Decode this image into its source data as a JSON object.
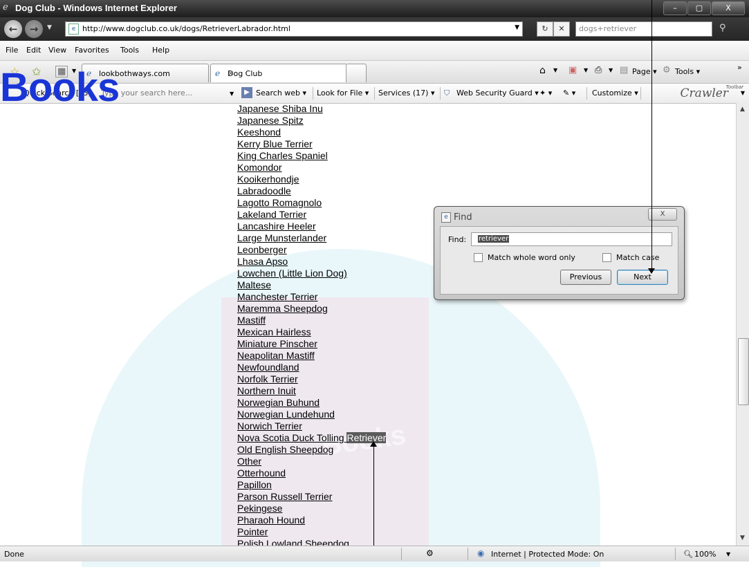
{
  "window": {
    "title": "Dog Club - Windows Internet Explorer",
    "buttons": [
      "–",
      "▢",
      "X"
    ]
  },
  "address_bar": {
    "url": "http://www.dogclub.co.uk/dogs/RetrieverLabrador.html",
    "search_value": "dogs+retriever"
  },
  "menu": [
    "File",
    "Edit",
    "View",
    "Favorites",
    "Tools",
    "Help"
  ],
  "tabs": [
    {
      "label": "lookbothways.com",
      "active": false
    },
    {
      "label": "Dog Club",
      "active": true
    }
  ],
  "command_bar": {
    "page_label": "Page",
    "tools_label": "Tools"
  },
  "links_toolbar": {
    "quick_search": "Quick Search [F3]",
    "search_placeholder": "Type your search here...",
    "search_web": "Search web",
    "look_for_file": "Look for File",
    "services": "Services (17)",
    "web_security_guard": "Web Security Guard",
    "customize": "Customize",
    "brand": "Crawler",
    "brand_small": "Toolbar"
  },
  "watermark": {
    "text": "Books",
    "bg_text": "Books"
  },
  "dog_breeds": [
    "Japanese Shiba Inu",
    "Japanese Spitz",
    "Keeshond",
    "Kerry Blue Terrier",
    "King Charles Spaniel",
    "Komondor",
    "Kooikerhondje",
    "Labradoodle",
    "Lagotto Romagnolo",
    "Lakeland Terrier",
    "Lancashire Heeler",
    "Large Munsterlander",
    "Leonberger",
    "Lhasa Apso",
    "Lowchen (Little Lion Dog)",
    "Maltese",
    "Manchester Terrier",
    "Maremma Sheepdog",
    "Mastiff",
    "Mexican Hairless",
    "Miniature Pinscher",
    "Neapolitan Mastiff",
    "Newfoundland",
    "Norfolk Terrier",
    "Northern Inuit",
    "Norwegian Buhund",
    "Norwegian Lundehund",
    "Norwich Terrier",
    "Nova Scotia Duck Tolling Retriever",
    "Old English Sheepdog",
    "Other",
    "Otterhound",
    "Papillon",
    "Parson Russell Terrier",
    "Pekingese",
    "Pharaoh Hound",
    "Pointer",
    "Polish Lowland Sheepdog"
  ],
  "highlight": {
    "prefix": "Nova Scotia Duck Tolling ",
    "match": "Retriever"
  },
  "find_dialog": {
    "title": "Find",
    "close_glyph": "X",
    "find_label": "Find:",
    "find_value": "retriever",
    "match_whole_word": "Match whole word only",
    "match_case": "Match case",
    "previous": "Previous",
    "next": "Next"
  },
  "status_bar": {
    "status": "Done",
    "zone": "Internet | Protected Mode: On",
    "zoom": "100%"
  }
}
